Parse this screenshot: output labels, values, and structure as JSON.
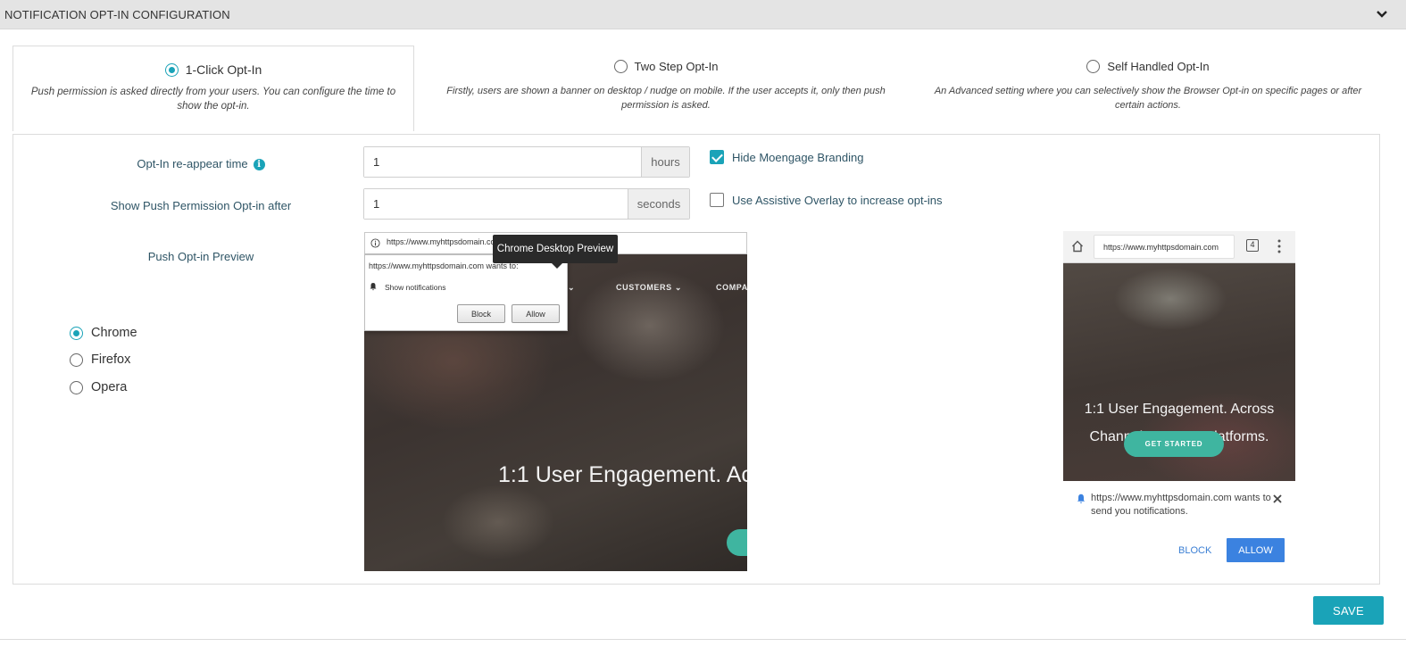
{
  "header": {
    "title": "NOTIFICATION OPT-IN CONFIGURATION",
    "icon": "chevron-down-icon"
  },
  "optin_types": [
    {
      "label": "1-Click Opt-In",
      "selected": true,
      "description": "Push permission is asked directly from your users. You can configure the time to show the opt-in."
    },
    {
      "label": "Two Step Opt-In",
      "selected": false,
      "description": "Firstly, users are shown a banner on desktop / nudge on mobile. If the user accepts it, only then push permission is asked."
    },
    {
      "label": "Self Handled Opt-In",
      "selected": false,
      "description": "An Advanced setting where you can selectively show the Browser Opt-in on specific pages or after certain actions."
    }
  ],
  "settings": {
    "reappear_label": "Opt-In re-appear time",
    "reappear_value": "1",
    "reappear_unit": "hours",
    "show_after_label": "Show Push Permission Opt-in after",
    "show_after_value": "1",
    "show_after_unit": "seconds",
    "preview_label": "Push Opt-in Preview",
    "hide_branding_label": "Hide Moengage Branding",
    "hide_branding_checked": true,
    "assistive_overlay_label": "Use Assistive Overlay to increase opt-ins",
    "assistive_overlay_checked": false
  },
  "browsers": [
    {
      "label": "Chrome",
      "selected": true
    },
    {
      "label": "Firefox",
      "selected": false
    },
    {
      "label": "Opera",
      "selected": false
    }
  ],
  "desktop_preview": {
    "tooltip": "Chrome Desktop Preview",
    "url": "https://www.myhttpsdomain.co",
    "site_wants": "https://www.myhttpsdomain.com wants to:",
    "show_notifications": "Show notifications",
    "block": "Block",
    "allow": "Allow",
    "nav_customers": "CUSTOMERS",
    "nav_company": "COMPA",
    "hero": "1:1 User Engagement. Ac"
  },
  "mobile_preview": {
    "url": "https://www.myhttpsdomain.com",
    "tab_count": "4",
    "hero_line1": "1:1 User Engagement. Across",
    "hero_line2": "Channels. Across Platforms.",
    "cta": "GET STARTED",
    "notification": "https://www.myhttpsdomain.com wants to send you notifications.",
    "block": "BLOCK",
    "allow": "ALLOW"
  },
  "save_label": "SAVE",
  "colors": {
    "accent": "#1aa3b8",
    "allow_blue": "#3b82e0",
    "header_bg": "#e4e4e4"
  }
}
